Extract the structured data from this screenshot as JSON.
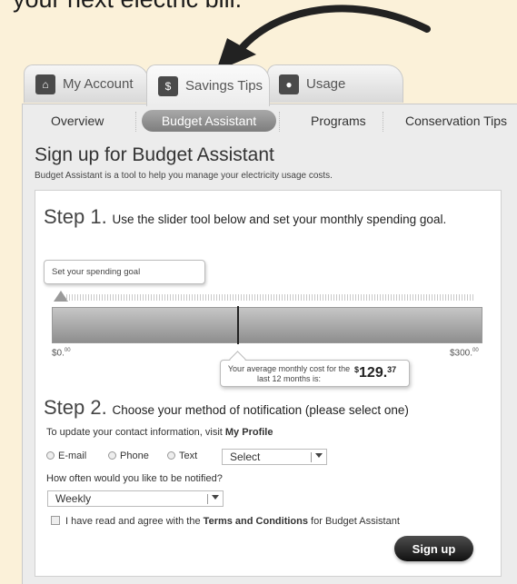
{
  "headline": "your next electric bill.",
  "tabs": [
    {
      "label": "My Account",
      "icon": "home-icon"
    },
    {
      "label": "Savings Tips",
      "icon": "piggy-bank-icon"
    },
    {
      "label": "Usage",
      "icon": "lightbulb-icon"
    }
  ],
  "subnav": {
    "overview": "Overview",
    "budget": "Budget Assistant",
    "programs": "Programs",
    "conservation": "Conservation Tips"
  },
  "page": {
    "title": "Sign up for Budget Assistant",
    "description": "Budget Assistant is a tool to help you manage your electricity usage costs."
  },
  "step1": {
    "number": "Step 1.",
    "text": "Use the slider tool below and set your monthly spending goal.",
    "goal_bubble": "Set your spending goal",
    "min_label": "$0.",
    "min_cents": "00",
    "max_label": "$300.",
    "max_cents": "00",
    "avg_label": "Your average monthly cost for the last 12 months is:",
    "avg_currency": "$",
    "avg_dollars": "129.",
    "avg_cents": "37",
    "slider_fraction": 0.431
  },
  "step2": {
    "number": "Step 2.",
    "text": "Choose your method of notification (please select one)",
    "contact_prefix": "To update your contact information, visit",
    "contact_link": "My Profile",
    "methods": [
      "E-mail",
      "Phone",
      "Text"
    ],
    "method_select": "Select",
    "frequency_label": "How often would you like to be notified?",
    "frequency_value": "Weekly",
    "terms_prefix": "I have read and agree with the",
    "terms_link": "Terms and Conditions",
    "terms_suffix": "for Budget Assistant",
    "signup_label": "Sign up"
  },
  "colors": {
    "background": "#fbf1d9",
    "panel": "#ececec",
    "pill": "#8a8a8a",
    "button": "#1a1a1a"
  }
}
